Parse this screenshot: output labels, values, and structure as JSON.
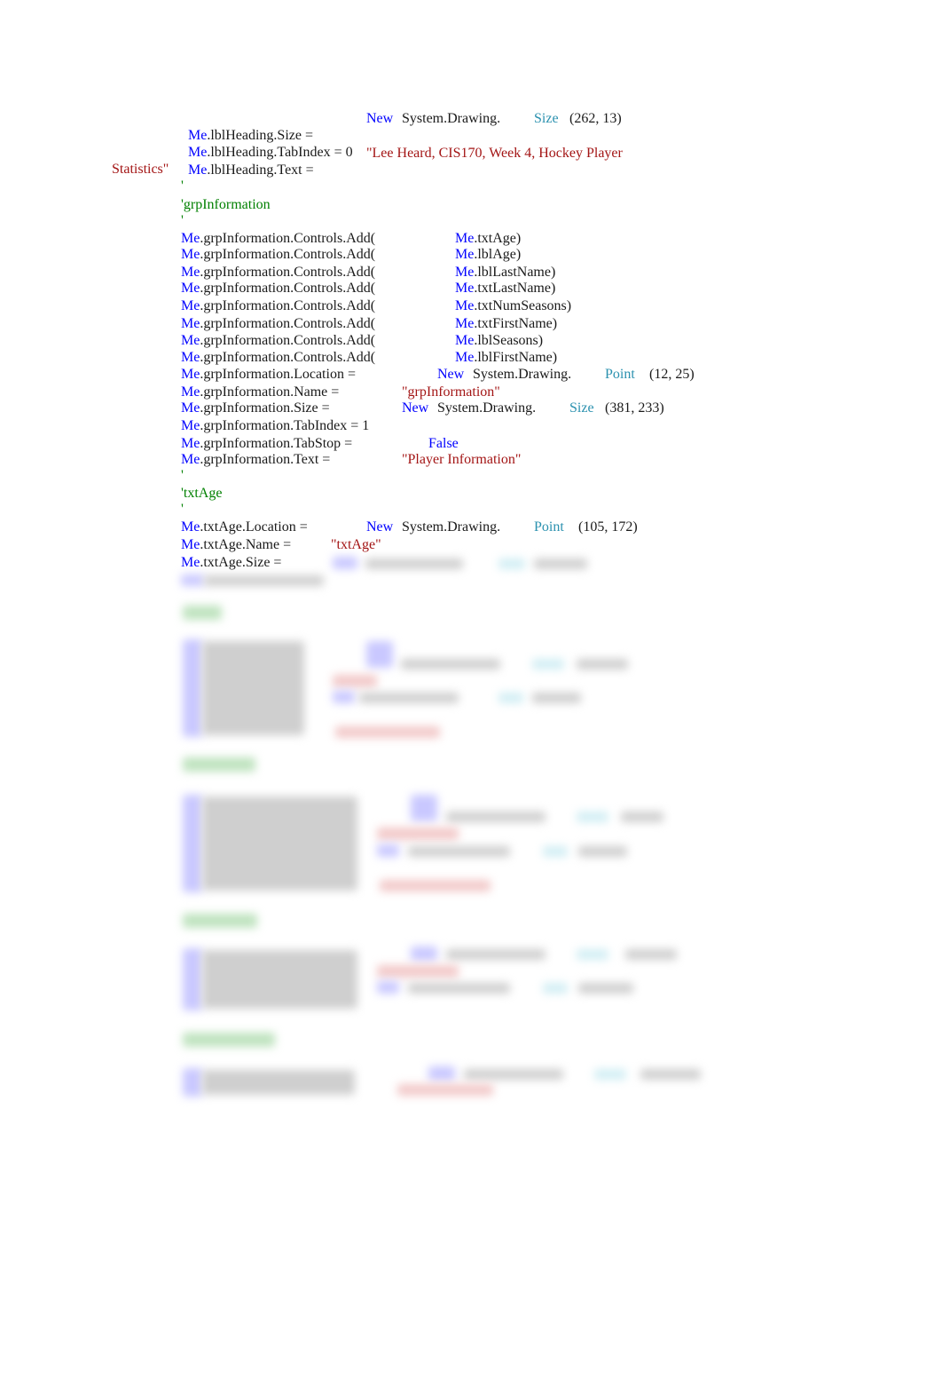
{
  "document": {
    "lines": [
      {
        "me": "Me",
        "member": ".lblHeading.Size =",
        "kw": "New",
        "ns": "System.Drawing.",
        "type": "Size",
        "args": "(262, 13)"
      },
      {
        "me": "Me",
        "member": ".lblHeading.TabIndex = 0"
      },
      {
        "me": "Me",
        "member": ".lblHeading.Text =",
        "string": "\"Lee Heard, CIS170, Week 4, Hockey Player",
        "string_cont": "Statistics\""
      },
      {
        "comment": "'"
      },
      {
        "comment": "'grpInformation"
      },
      {
        "comment": "'"
      },
      {
        "me": "Me",
        "member": ".grpInformation.Controls.Add(",
        "me2": "Me",
        "arg": ".txtAge)"
      },
      {
        "me": "Me",
        "member": ".grpInformation.Controls.Add(",
        "me2": "Me",
        "arg": ".lblAge)"
      },
      {
        "me": "Me",
        "member": ".grpInformation.Controls.Add(",
        "me2": "Me",
        "arg": ".lblLastName)"
      },
      {
        "me": "Me",
        "member": ".grpInformation.Controls.Add(",
        "me2": "Me",
        "arg": ".txtLastName)"
      },
      {
        "me": "Me",
        "member": ".grpInformation.Controls.Add(",
        "me2": "Me",
        "arg": ".txtNumSeasons)"
      },
      {
        "me": "Me",
        "member": ".grpInformation.Controls.Add(",
        "me2": "Me",
        "arg": ".txtFirstName)"
      },
      {
        "me": "Me",
        "member": ".grpInformation.Controls.Add(",
        "me2": "Me",
        "arg": ".lblSeasons)"
      },
      {
        "me": "Me",
        "member": ".grpInformation.Controls.Add(",
        "me2": "Me",
        "arg": ".lblFirstName)"
      },
      {
        "me": "Me",
        "member": ".grpInformation.Location =",
        "kw": "New",
        "ns": "System.Drawing.",
        "type": "Point",
        "args": "(12, 25)"
      },
      {
        "me": "Me",
        "member": ".grpInformation.Name =",
        "string": "\"grpInformation\""
      },
      {
        "me": "Me",
        "member": ".grpInformation.Size =",
        "kw": "New",
        "ns": "System.Drawing.",
        "type": "Size",
        "args": "(381, 233)"
      },
      {
        "me": "Me",
        "member": ".grpInformation.TabIndex = 1"
      },
      {
        "me": "Me",
        "member": ".grpInformation.TabStop =",
        "kw": "False"
      },
      {
        "me": "Me",
        "member": ".grpInformation.Text =",
        "string": "\"Player Information\""
      },
      {
        "comment": "'"
      },
      {
        "comment": "'txtAge"
      },
      {
        "comment": "'"
      },
      {
        "me": "Me",
        "member": ".txtAge.Location =",
        "kw": "New",
        "ns": "System.Drawing.",
        "type": "Point",
        "args": "(105, 172)"
      },
      {
        "me": "Me",
        "member": ".txtAge.Name =",
        "string": "\"txtAge\""
      },
      {
        "me": "Me",
        "member": ".txtAge.Size ="
      }
    ],
    "blurred_notice": "remaining content obscured (blurred preview)"
  },
  "colors": {
    "keyword": "#0000ff",
    "type": "#2b91af",
    "string": "#a31515",
    "comment": "#008000",
    "text": "#1a1a1a",
    "background": "#ffffff"
  }
}
